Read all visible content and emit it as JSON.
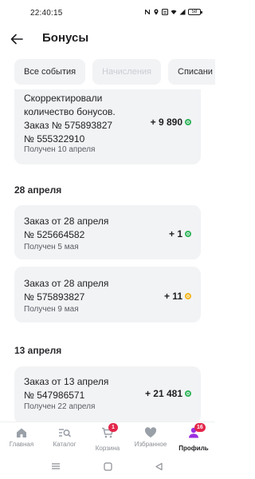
{
  "status_bar": {
    "time": "22:40:15",
    "battery": "58"
  },
  "header": {
    "title": "Бонусы"
  },
  "filters": [
    {
      "label": "Все события",
      "active": false
    },
    {
      "label": "Начисления",
      "active": true
    },
    {
      "label": "Списани",
      "active": false
    }
  ],
  "entries": {
    "e0": {
      "lines": [
        "Скорректировали",
        "количество бонусов.",
        "Заказ № 575893827",
        "№ 555322910"
      ],
      "received": "Получен 10 апреля",
      "amount": "+ 9 890",
      "coin_color": "#2fb45a"
    },
    "e1": {
      "lines": [
        "Заказ от 28 апреля",
        "№ 525664582"
      ],
      "received": "Получен 5 мая",
      "amount": "+ 1",
      "coin_color": "#2fb45a"
    },
    "e2": {
      "lines": [
        "Заказ от 28 апреля",
        "№ 575893827"
      ],
      "received": "Получен 9 мая",
      "amount": "+ 11",
      "coin_color": "#f2b51b"
    },
    "e3": {
      "lines": [
        "Заказ от 13 апреля",
        "№ 547986571"
      ],
      "received": "Получен 22 апреля",
      "amount": "+ 21 481",
      "coin_color": "#2fb45a"
    }
  },
  "sections": {
    "s1": "28 апреля",
    "s2": "13 апреля"
  },
  "bottom_nav": {
    "home": {
      "label": "Главная",
      "icon": "home-icon"
    },
    "catalog": {
      "label": "Каталог",
      "icon": "catalog-search-icon"
    },
    "cart": {
      "label": "Корзина",
      "icon": "cart-icon",
      "badge": "1"
    },
    "favorites": {
      "label": "Избранное",
      "icon": "heart-icon"
    },
    "profile": {
      "label": "Профиль",
      "icon": "profile-icon",
      "badge": "16",
      "active": true
    }
  },
  "colors": {
    "accent": "#9b2fe0",
    "badge": "#e3264a",
    "card_bg": "#f2f3f5",
    "bonus_green": "#2fb45a",
    "bonus_gold": "#f2b51b"
  }
}
